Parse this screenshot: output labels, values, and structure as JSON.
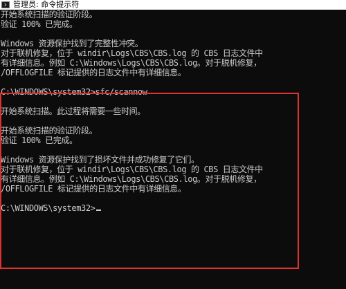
{
  "window": {
    "title": "管理员: 命令提示符",
    "icon": "cmd-icon"
  },
  "console": {
    "lines": [
      "开始系统扫描的验证阶段。",
      "验证 100% 已完成。",
      "",
      "Windows 资源保护找到了完整性冲突。",
      "对于联机修复，位于 windir\\Logs\\CBS\\CBS.log 的 CBS 日志文件中",
      "有详细信息。例如 C:\\Windows\\Logs\\CBS\\CBS.log。对于脱机修复，",
      "/OFFLOGFILE 标记提供的日志文件中有详细信息。",
      "",
      "C:\\WINDOWS\\system32>sfc/scannow",
      "",
      "开始系统扫描。此过程将需要一些时间。",
      "",
      "开始系统扫描的验证阶段。",
      "验证 100% 已完成。",
      "",
      "Windows 资源保护找到了损坏文件并成功修复了它们。",
      "对于联机修复，位于 windir\\Logs\\CBS\\CBS.log 的 CBS 日志文件中",
      "有详细信息。例如 C:\\Windows\\Logs\\CBS\\CBS.log。对于脱机修复，",
      "/OFFLOGFILE 标记提供的日志文件中有详细信息。",
      "",
      "C:\\WINDOWS\\system32>"
    ]
  },
  "colors": {
    "background": "#0c0c0c",
    "text": "#cccccc",
    "highlight": "#e03030"
  }
}
